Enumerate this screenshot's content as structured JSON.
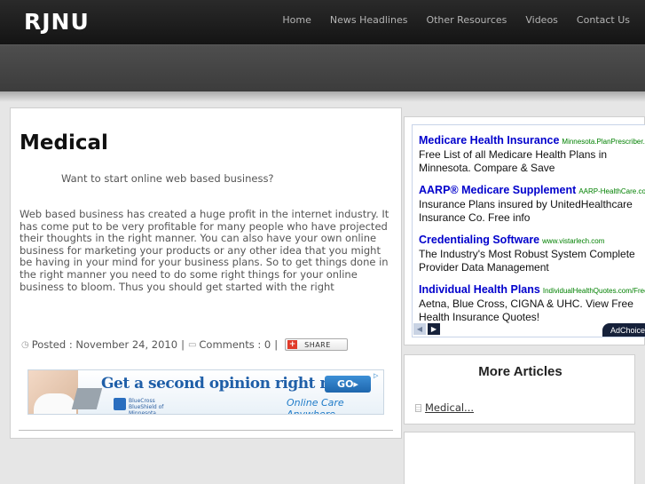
{
  "header": {
    "logo": "RJNU",
    "nav": [
      "Home",
      "News Headlines",
      "Other Resources",
      "Videos",
      "Contact Us"
    ]
  },
  "post": {
    "title": "Medical",
    "lead": "Want to start online web based business?",
    "body": "Web based business has created a huge profit in the internet industry. It has come put to be very profitable for many people who have projected their thoughts in the right manner. You can also have your own online business for marketing your products or any other idea that you might be having in your mind for your business plans. So to get things done in the right manner you need to do some right things for your online business to bloom. Thus you should get started with the right",
    "posted": "Posted : November 24, 2010",
    "comments": "Comments : 0",
    "sep": "|",
    "share_label": "SHARE",
    "share_plus": "+"
  },
  "banner": {
    "headline": "Get a second opinion right now",
    "go": "GO▸",
    "org": "BlueCross BlueShield of Minnesota",
    "cta": "Online Care Anywhere",
    "ad_icon": "▷"
  },
  "ads": [
    {
      "title": "Medicare Health Insurance",
      "url": "Minnesota.PlanPrescriber.com",
      "desc": "Free List of all Medicare Health Plans in Minnesota. Compare & Save"
    },
    {
      "title": "AARP® Medicare Supplement",
      "url": "AARP-HealthCare.com",
      "desc": "Insurance Plans insured by UnitedHealthcare Insurance Co. Free info"
    },
    {
      "title": "Credentialing Software",
      "url": "www.vistarlech.com",
      "desc": "The Industry's Most Robust System Complete Provider Data Management"
    },
    {
      "title": "Individual Health Plans",
      "url": "IndividualHealthQuotes.com/Free",
      "desc": "Aetna, Blue Cross, CIGNA & UHC. View Free Health Insurance Quotes!"
    }
  ],
  "ad_nav": {
    "prev": "◀",
    "next": "▶",
    "adchoices": "AdChoices"
  },
  "sidebar": {
    "more_title": "More Articles",
    "more_items": [
      "Medical..."
    ]
  },
  "colors": {
    "ad_title": "#0000cc",
    "ad_url": "#008000",
    "banner_blue": "#1f5fa8"
  },
  "icons": {
    "posted": "clock-icon",
    "comments": "comment-icon",
    "share": "share-plus-icon",
    "article": "document-icon"
  }
}
